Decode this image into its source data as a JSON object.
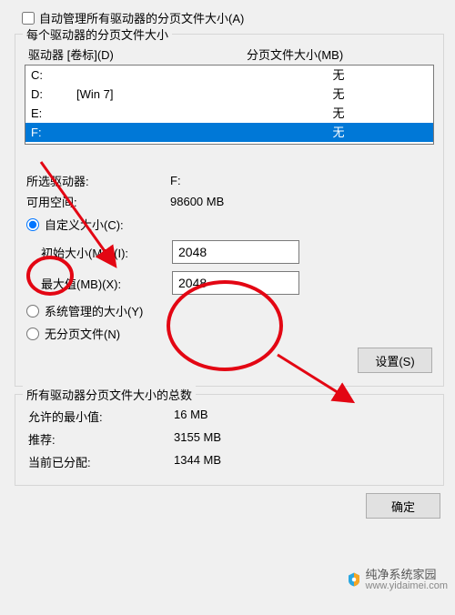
{
  "auto_manage": {
    "label": "自动管理所有驱动器的分页文件大小(A)",
    "checked": false
  },
  "per_drive_group": {
    "title": "每个驱动器的分页文件大小",
    "header_drive": "驱动器 [卷标](D)",
    "header_pf": "分页文件大小(MB)",
    "drives": [
      {
        "letter": "C:",
        "label": "",
        "pf": "无",
        "selected": false
      },
      {
        "letter": "D:",
        "label": "[Win 7]",
        "pf": "无",
        "selected": false
      },
      {
        "letter": "E:",
        "label": "",
        "pf": "无",
        "selected": false
      },
      {
        "letter": "F:",
        "label": "",
        "pf": "无",
        "selected": true
      }
    ],
    "selected_drive_label": "所选驱动器:",
    "selected_drive_value": "F:",
    "available_label": "可用空间:",
    "available_value": "98600 MB",
    "custom_size_label": "自定义大小(C):",
    "initial_label": "初始大小(MB)(I):",
    "initial_value": "2048",
    "max_label": "最大值(MB)(X):",
    "max_value": "2048",
    "system_managed_label": "系统管理的大小(Y)",
    "no_paging_label": "无分页文件(N)",
    "set_button": "设置(S)",
    "size_option": "custom"
  },
  "totals_group": {
    "title": "所有驱动器分页文件大小的总数",
    "min_label": "允许的最小值:",
    "min_value": "16 MB",
    "rec_label": "推荐:",
    "rec_value": "3155 MB",
    "alloc_label": "当前已分配:",
    "alloc_value": "1344 MB"
  },
  "buttons": {
    "ok": "确定"
  },
  "watermark": {
    "name": "纯净系统家园",
    "url": "www.yidaimei.com"
  },
  "annotation_color": "#e30613"
}
